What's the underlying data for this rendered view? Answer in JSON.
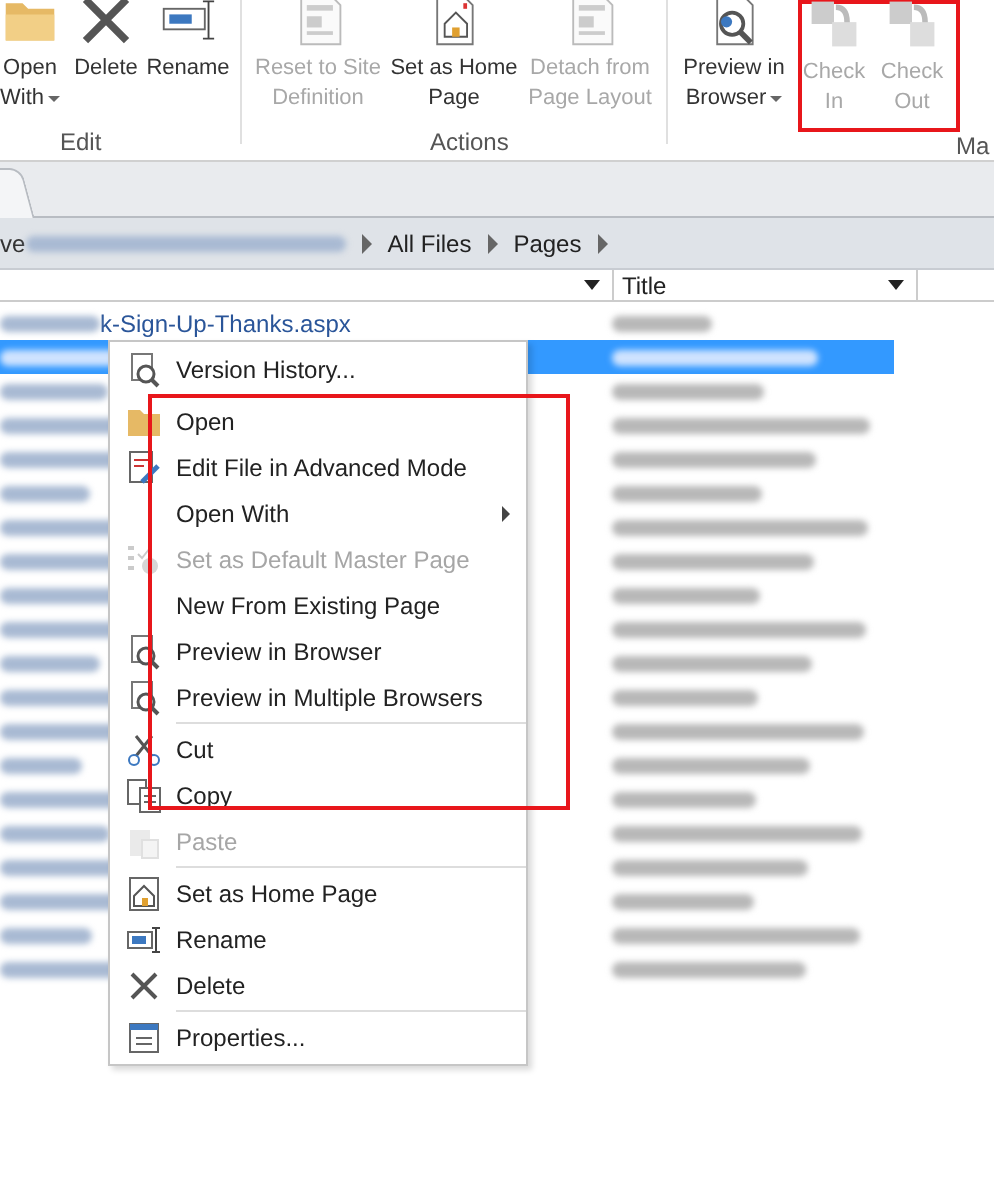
{
  "ribbon": {
    "buttons": [
      {
        "label": "Open With",
        "disabled": false,
        "dropdown": true
      },
      {
        "label": "Delete",
        "disabled": false,
        "dropdown": false
      },
      {
        "label": "Rename",
        "disabled": false,
        "dropdown": false
      },
      {
        "label": "Reset to Site Definition",
        "disabled": true,
        "dropdown": false
      },
      {
        "label": "Set as Home Page",
        "disabled": false,
        "dropdown": false
      },
      {
        "label": "Detach from Page Layout",
        "disabled": true,
        "dropdown": false
      },
      {
        "label": "Preview in Browser",
        "disabled": false,
        "dropdown": true
      },
      {
        "label": "Check In",
        "disabled": true,
        "dropdown": false
      },
      {
        "label": "Check Out",
        "disabled": true,
        "dropdown": false
      }
    ],
    "groups": [
      "Edit",
      "Actions",
      "Ma"
    ]
  },
  "breadcrumb": [
    "ve",
    "All Files",
    "Pages"
  ],
  "columns": [
    {
      "filter": true
    },
    {
      "label": "Title",
      "filter": true
    }
  ],
  "rows": [
    {
      "name": "k-Sign-Up-Thanks.aspx",
      "selected": false
    },
    {
      "selected": true
    },
    {
      "selected": false
    },
    {
      "selected": false
    },
    {
      "selected": false
    },
    {
      "selected": false
    },
    {
      "selected": false
    },
    {
      "selected": false
    },
    {
      "selected": false
    },
    {
      "selected": false
    },
    {
      "selected": false
    },
    {
      "selected": false
    },
    {
      "selected": false
    },
    {
      "selected": false
    },
    {
      "selected": false
    },
    {
      "selected": false
    },
    {
      "selected": false
    },
    {
      "selected": false
    },
    {
      "selected": false
    },
    {
      "selected": false
    }
  ],
  "context_menu": [
    {
      "kind": "item",
      "label": "Version History...",
      "disabled": false,
      "submenu": false
    },
    {
      "kind": "separator"
    },
    {
      "kind": "item",
      "label": "Open",
      "disabled": false,
      "submenu": false
    },
    {
      "kind": "item",
      "label": "Edit File in Advanced Mode",
      "disabled": false,
      "submenu": false
    },
    {
      "kind": "item",
      "label": "Open With",
      "disabled": false,
      "submenu": true
    },
    {
      "kind": "item",
      "label": "Set as Default Master Page",
      "disabled": true,
      "submenu": false
    },
    {
      "kind": "item",
      "label": "New From Existing Page",
      "disabled": false,
      "submenu": false
    },
    {
      "kind": "item",
      "label": "Preview in Browser",
      "disabled": false,
      "submenu": false
    },
    {
      "kind": "item",
      "label": "Preview in Multiple Browsers",
      "disabled": false,
      "submenu": false
    },
    {
      "kind": "separator"
    },
    {
      "kind": "item",
      "label": "Cut",
      "disabled": false,
      "submenu": false
    },
    {
      "kind": "item",
      "label": "Copy",
      "disabled": false,
      "submenu": false
    },
    {
      "kind": "item",
      "label": "Paste",
      "disabled": true,
      "submenu": false
    },
    {
      "kind": "separator"
    },
    {
      "kind": "item",
      "label": "Set as Home Page",
      "disabled": false,
      "submenu": false
    },
    {
      "kind": "item",
      "label": "Rename",
      "disabled": false,
      "submenu": false
    },
    {
      "kind": "item",
      "label": "Delete",
      "disabled": false,
      "submenu": false
    },
    {
      "kind": "separator"
    },
    {
      "kind": "item",
      "label": "Properties...",
      "disabled": false,
      "submenu": false
    }
  ]
}
